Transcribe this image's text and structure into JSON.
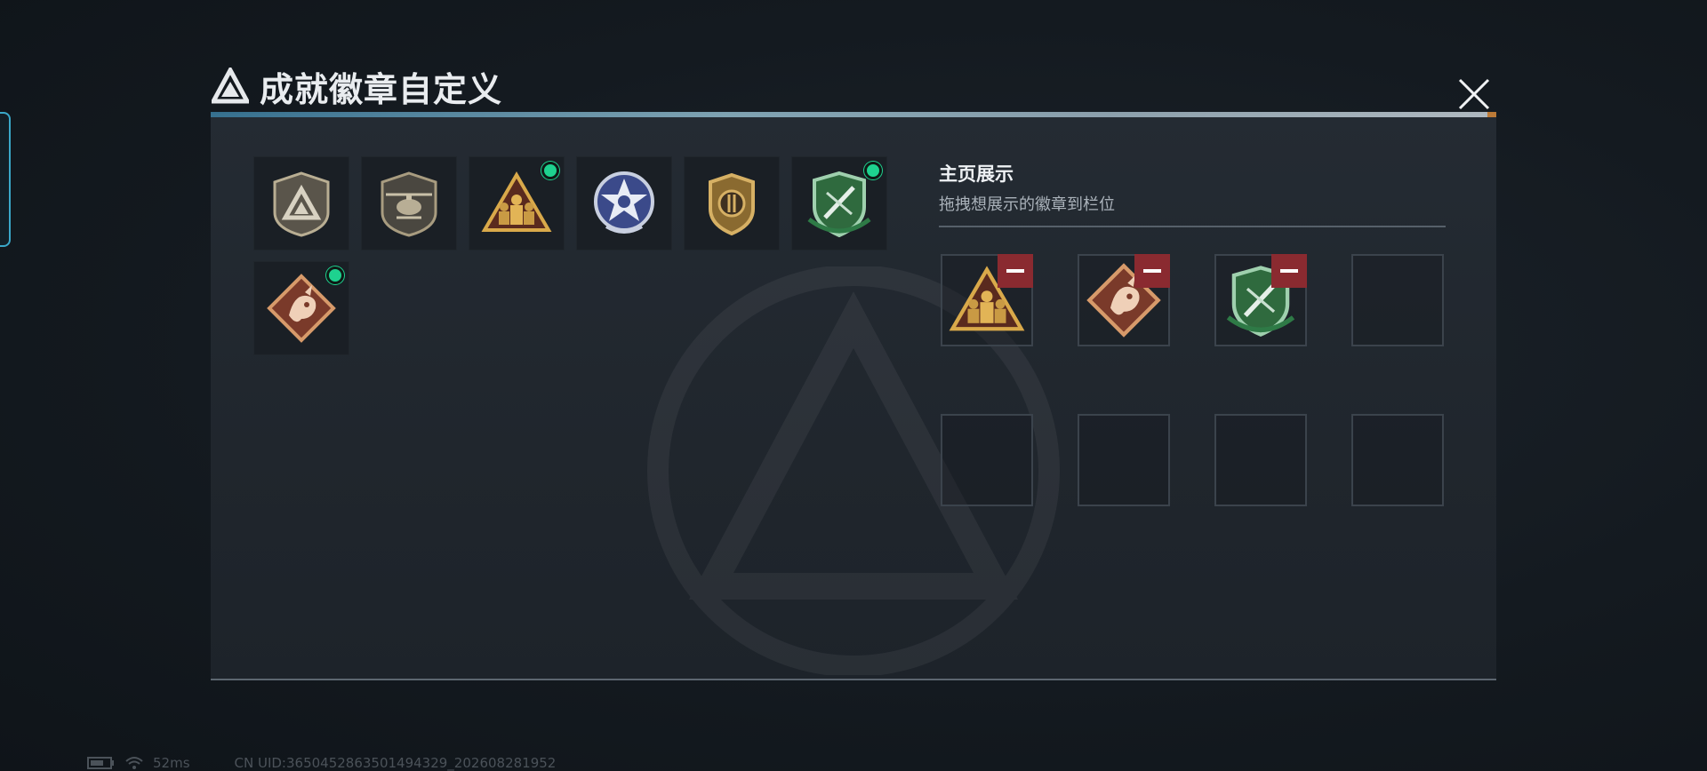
{
  "dialog": {
    "title": "成就徽章自定义",
    "close_icon": "close-icon"
  },
  "badges": [
    {
      "name": "mountain-triangle-badge",
      "equipped": false
    },
    {
      "name": "helicopter-shield-badge",
      "equipped": false
    },
    {
      "name": "soldiers-triangle-badge",
      "equipped": true
    },
    {
      "name": "star-wreath-badge",
      "equipped": false
    },
    {
      "name": "gold-shield-badge",
      "equipped": false
    },
    {
      "name": "green-shield-daggers-badge",
      "equipped": true
    },
    {
      "name": "dragon-diamond-badge",
      "equipped": true
    }
  ],
  "display": {
    "title": "主页展示",
    "subtitle": "拖拽想展示的徽章到栏位"
  },
  "slots": [
    {
      "badge": "soldiers-triangle-badge"
    },
    {
      "badge": "dragon-diamond-badge"
    },
    {
      "badge": "green-shield-daggers-badge"
    },
    {
      "badge": ""
    },
    {
      "badge": ""
    },
    {
      "badge": ""
    },
    {
      "badge": ""
    },
    {
      "badge": ""
    }
  ],
  "status": {
    "ping": "52ms",
    "uid": "CN UID:3650452863501494329_202608281952"
  },
  "colors": {
    "accent_equipped": "#1ed28f",
    "remove": "#8a2a30",
    "panel": "#242b33"
  }
}
